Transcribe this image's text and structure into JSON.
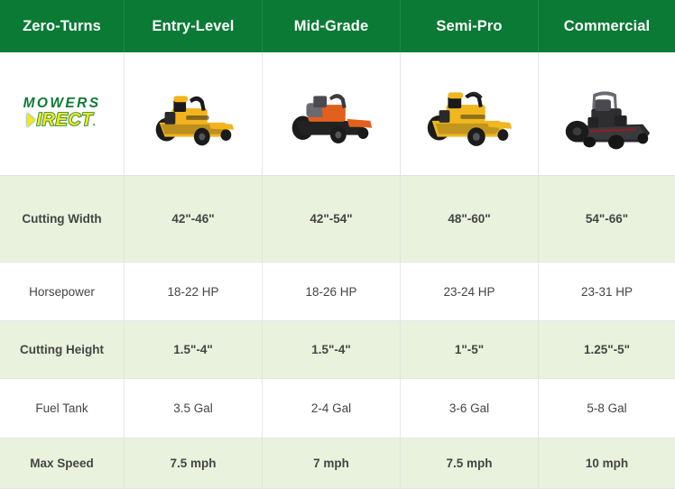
{
  "table": {
    "headers": [
      "Zero-Turns",
      "Entry-Level",
      "Mid-Grade",
      "Semi-Pro",
      "Commercial"
    ],
    "brand": {
      "logo_top": "MOWERS",
      "logo_bottom": "IRECT",
      "logo_dot": ".",
      "logo_color_top": "#0d7a35",
      "logo_color_bottom": "#f5e61e"
    },
    "products": [
      {
        "name": "entry-level-mower",
        "alt": "Yellow and black entry-level zero-turn mower",
        "body": "#f2b41c",
        "accent": "#1a1a1a",
        "deck": "#f2b41c"
      },
      {
        "name": "mid-grade-mower",
        "alt": "Orange and grey mid-grade zero-turn mower",
        "body": "#e2601d",
        "accent": "#5a5a5e",
        "deck": "#2b2b2b"
      },
      {
        "name": "semi-pro-mower",
        "alt": "Yellow semi-pro zero-turn mower",
        "body": "#f0b81e",
        "accent": "#2a2a2a",
        "deck": "#f0b81e"
      },
      {
        "name": "commercial-mower",
        "alt": "Black commercial zero-turn mower",
        "body": "#3a3a3c",
        "accent": "#1a1a1a",
        "deck": "#2a2a2c"
      }
    ],
    "rows": [
      {
        "label": "Cutting Width",
        "shaded": true,
        "values": [
          "42\"-46\"",
          "42\"-54\"",
          "48\"-60\"",
          "54\"-66\""
        ]
      },
      {
        "label": "Horsepower",
        "shaded": false,
        "values": [
          "18-22 HP",
          "18-26 HP",
          "23-24 HP",
          "23-31 HP"
        ]
      },
      {
        "label": "Cutting Height",
        "shaded": true,
        "values": [
          "1.5\"-4\"",
          "1.5\"-4\"",
          "1\"-5\"",
          "1.25\"-5\""
        ]
      },
      {
        "label": "Fuel Tank",
        "shaded": false,
        "values": [
          "3.5 Gal",
          "2-4 Gal",
          "3-6 Gal",
          "5-8 Gal"
        ]
      },
      {
        "label": "Max Speed",
        "shaded": true,
        "values": [
          "7.5 mph",
          "7 mph",
          "7.5 mph",
          "10 mph"
        ]
      }
    ],
    "colors": {
      "header_bg": "#0a7a35",
      "header_text": "#ffffff",
      "shaded_row_bg": "#e9f2dd",
      "plain_row_bg": "#ffffff",
      "cell_text": "#454545",
      "border": "#e6e6e6"
    }
  }
}
